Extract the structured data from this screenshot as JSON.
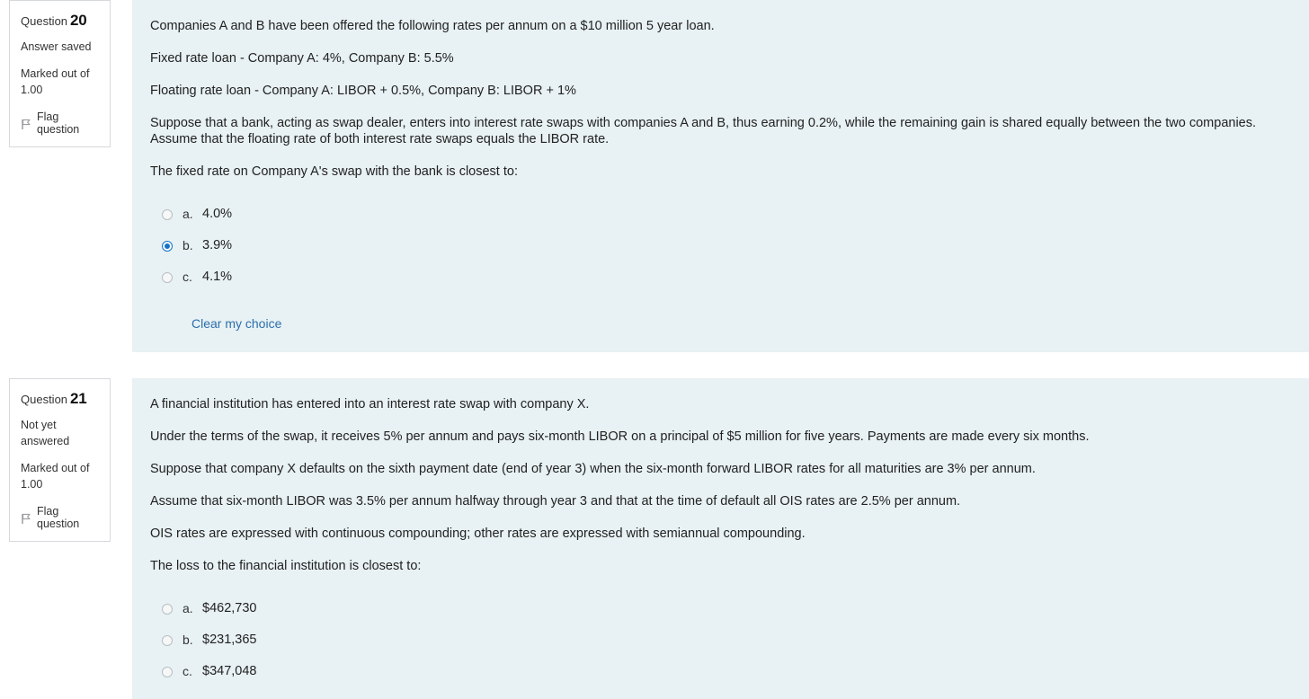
{
  "theme": {
    "panel_bg": "#e8f1f3",
    "page_bg": "#ffffff",
    "box_border": "#d6d9dc",
    "link_color": "#2c6fad",
    "radio_checked_color": "#1473c8",
    "text_color": "#222222"
  },
  "questions": [
    {
      "info": {
        "label": "Question",
        "number": "20",
        "state": "Answer saved",
        "marks_label": "Marked out of",
        "marks_value": "1.00",
        "flag_label": "Flag question",
        "flag_icon": "flag-icon"
      },
      "paragraphs": [
        "Companies A and B have been offered the following rates per annum on a $10 million 5 year loan.",
        "Fixed rate loan - Company A: 4%, Company B: 5.5%",
        "Floating rate loan - Company A: LIBOR + 0.5%, Company B: LIBOR + 1%",
        "Suppose that a bank, acting as swap dealer, enters into interest rate swaps with companies A and B, thus earning 0.2%, while the remaining gain is shared equally between the two companies. Assume that the floating rate of both interest rate swaps equals the LIBOR rate.",
        "The fixed rate on Company A's swap with the bank is closest to:"
      ],
      "options": [
        {
          "letter": "a.",
          "text": "4.0%",
          "selected": false
        },
        {
          "letter": "b.",
          "text": "3.9%",
          "selected": true
        },
        {
          "letter": "c.",
          "text": "4.1%",
          "selected": false
        }
      ],
      "clear_choice_label": "Clear my choice",
      "show_clear_choice": true
    },
    {
      "info": {
        "label": "Question",
        "number": "21",
        "state": "Not yet answered",
        "marks_label": "Marked out of",
        "marks_value": "1.00",
        "flag_label": "Flag question",
        "flag_icon": "flag-icon"
      },
      "paragraphs": [
        "A financial institution has entered into an interest rate swap with company X.",
        "Under the terms of the swap, it receives 5% per annum and pays six-month LIBOR on a principal of $5 million for five years. Payments are made every six months.",
        "Suppose that company X defaults on the sixth payment date (end of year 3) when the six-month forward LIBOR rates for all maturities are 3% per annum.",
        "Assume that six-month LIBOR was 3.5% per annum halfway through year 3 and that at the time of default all OIS rates are 2.5% per annum.",
        "OIS rates are expressed with continuous compounding; other rates are expressed with semiannual compounding.",
        "The loss to the financial institution is closest to:"
      ],
      "options": [
        {
          "letter": "a.",
          "text": "$462,730",
          "selected": false
        },
        {
          "letter": "b.",
          "text": "$231,365",
          "selected": false
        },
        {
          "letter": "c.",
          "text": "$347,048",
          "selected": false
        }
      ],
      "clear_choice_label": "Clear my choice",
      "show_clear_choice": false
    }
  ]
}
